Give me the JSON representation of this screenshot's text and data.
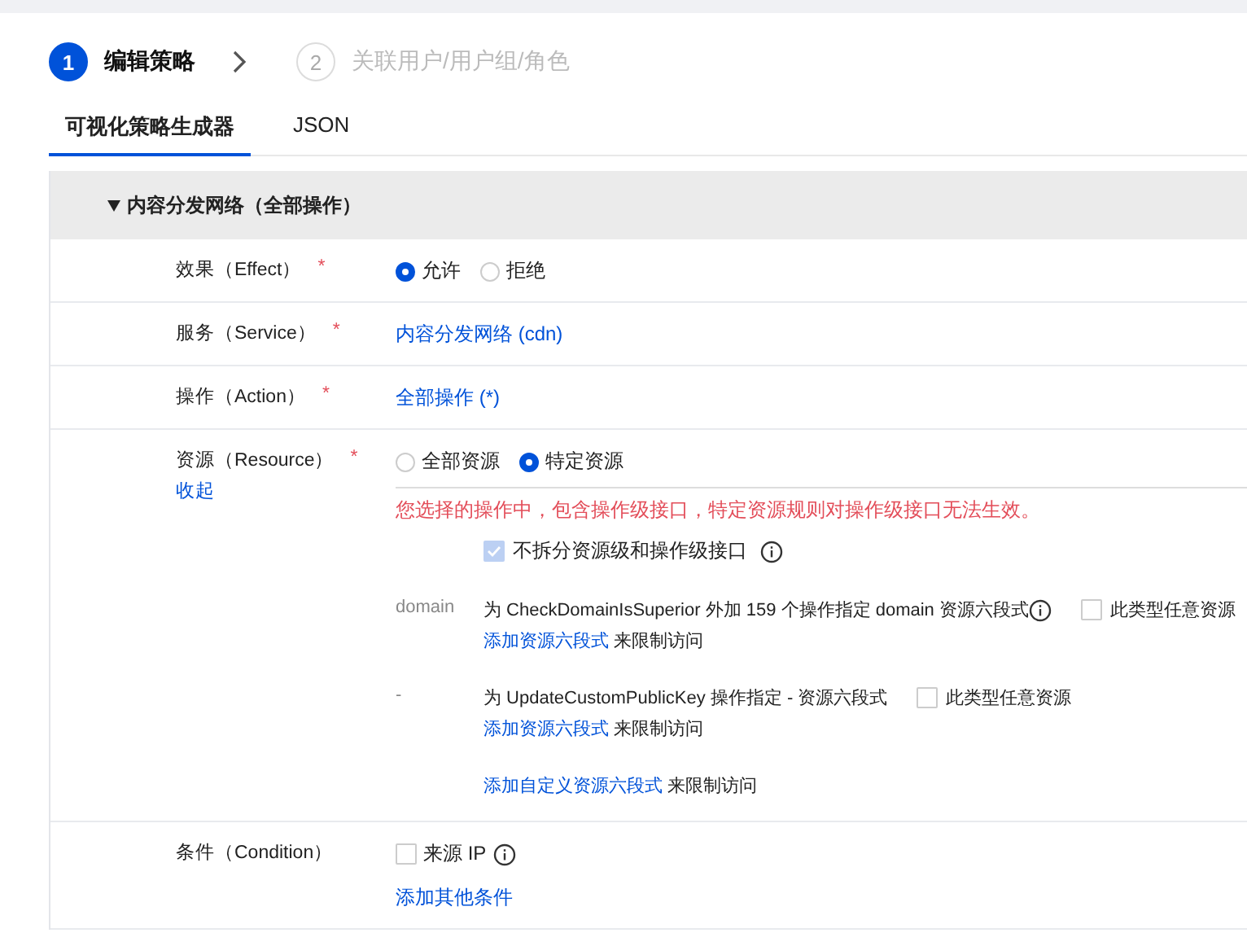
{
  "steps": [
    {
      "number": "1",
      "label": "编辑策略",
      "selected": true
    },
    {
      "number": "2",
      "label": "关联用户/用户组/角色",
      "selected": false
    }
  ],
  "tabs": [
    {
      "label": "可视化策略生成器",
      "selected": true
    },
    {
      "label": "JSON",
      "selected": false
    }
  ],
  "section": {
    "title": "内容分发网络（全部操作）",
    "expanded": true,
    "rows": [
      {
        "kind": "radio",
        "label": "效果（Effect）",
        "required_mark": "*",
        "options": [
          {
            "label": "允许",
            "selected": true
          },
          {
            "label": "拒绝",
            "selected": false
          }
        ]
      },
      {
        "kind": "link",
        "label": "服务（Service）",
        "required_mark": "*",
        "value": "内容分发网络 (cdn)"
      },
      {
        "kind": "link",
        "label": "操作（Action）",
        "required_mark": "*",
        "value": "全部操作 (*)"
      },
      {
        "kind": "resource",
        "label": "资源（Resource）",
        "required_mark": "*",
        "toggle": "收起",
        "options": [
          {
            "label": "全部资源",
            "selected": false
          },
          {
            "label": "特定资源",
            "selected": true
          }
        ],
        "warning": "您选择的操作中，包含操作级接口，特定资源规则对操作级接口无法生效。",
        "merge": {
          "label": "不拆分资源级和操作级接口",
          "checked": true,
          "disabled": true,
          "info": true
        },
        "groups": [
          {
            "type": "domain",
            "text": "为 CheckDomainIsSuperior 外加 159 个操作指定 domain 资源六段式",
            "info": true,
            "any": {
              "label": "此类型任意资源",
              "checked": false
            },
            "link": "添加资源六段式",
            "suffix": "来限制访问"
          },
          {
            "type": "-",
            "text": "为 UpdateCustomPublicKey 操作指定 - 资源六段式",
            "info": false,
            "any": {
              "label": "此类型任意资源",
              "checked": false
            },
            "link": "添加资源六段式",
            "suffix": "来限制访问"
          }
        ],
        "custom": {
          "link": "添加自定义资源六段式",
          "suffix": "来限制访问"
        }
      },
      {
        "kind": "condition",
        "label": "条件（Condition）",
        "options": [
          {
            "label": "来源 IP",
            "checked": false,
            "info": true
          }
        ],
        "link": "添加其他条件"
      }
    ]
  }
}
